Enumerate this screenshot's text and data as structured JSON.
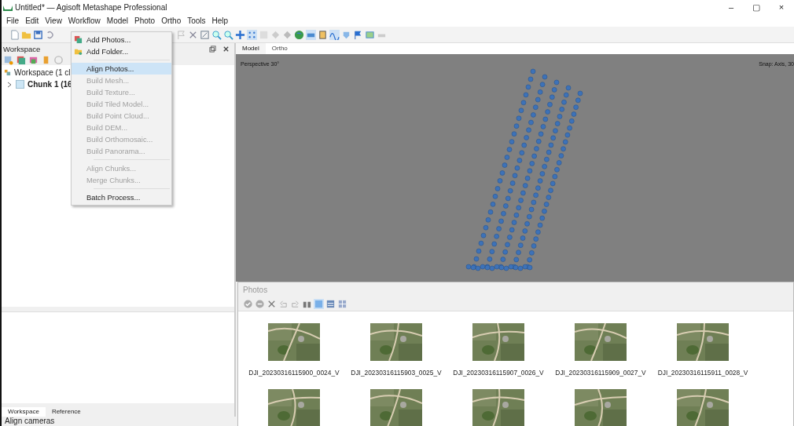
{
  "window": {
    "title": "Untitled* — Agisoft Metashape Professional",
    "controls": [
      "–",
      "▢",
      "×"
    ]
  },
  "menu_bar": [
    "File",
    "Edit",
    "View",
    "Workflow",
    "Model",
    "Photo",
    "Ortho",
    "Tools",
    "Help"
  ],
  "workflow_menu": [
    {
      "kind": "item",
      "label": "Add Photos...",
      "disabled": false,
      "selected": false
    },
    {
      "kind": "item",
      "label": "Add Folder...",
      "disabled": false,
      "selected": false
    },
    {
      "kind": "separator"
    },
    {
      "kind": "item",
      "label": "Align Photos...",
      "disabled": false,
      "selected": true
    },
    {
      "kind": "item",
      "label": "Build Mesh...",
      "disabled": true,
      "selected": false
    },
    {
      "kind": "item",
      "label": "Build Texture...",
      "disabled": true,
      "selected": false
    },
    {
      "kind": "item",
      "label": "Build Tiled Model...",
      "disabled": true,
      "selected": false
    },
    {
      "kind": "item",
      "label": "Build Point Cloud...",
      "disabled": true,
      "selected": false
    },
    {
      "kind": "item",
      "label": "Build DEM...",
      "disabled": true,
      "selected": false
    },
    {
      "kind": "item",
      "label": "Build Orthomosaic...",
      "disabled": true,
      "selected": false
    },
    {
      "kind": "item",
      "label": "Build Panorama...",
      "disabled": true,
      "selected": false
    },
    {
      "kind": "separator"
    },
    {
      "kind": "item",
      "label": "Align Chunks...",
      "disabled": true,
      "selected": false
    },
    {
      "kind": "item",
      "label": "Merge Chunks...",
      "disabled": true,
      "selected": false
    },
    {
      "kind": "separator"
    },
    {
      "kind": "item",
      "label": "Batch Process...",
      "disabled": false,
      "selected": false
    }
  ],
  "workspace": {
    "title": "Workspace",
    "tree": [
      {
        "label": "Workspace (1 cl",
        "children": [
          {
            "label": "Chunk 1 (16",
            "expanded": false
          }
        ]
      }
    ]
  },
  "viewport": {
    "tabs": [
      {
        "label": "Model",
        "selected": true
      },
      {
        "label": "Ortho",
        "selected": false
      }
    ],
    "projection": "Perspective 30°",
    "snap": "Snap: Axis, 30"
  },
  "photos": {
    "title": "Photos",
    "items": [
      {
        "kind": "picture",
        "label": "DJI_20230316115900_0024_V"
      },
      {
        "kind": "picture",
        "label": "DJI_20230316115903_0025_V"
      },
      {
        "kind": "picture",
        "label": "DJI_20230316115907_0026_V"
      },
      {
        "kind": "picture",
        "label": "DJI_20230316115909_0027_V"
      },
      {
        "kind": "picture",
        "label": "DJI_20230316115911_0028_V"
      },
      {
        "kind": "picture"
      },
      {
        "kind": "picture"
      },
      {
        "kind": "picture"
      },
      {
        "kind": "picture"
      },
      {
        "kind": "picture"
      }
    ]
  },
  "bottom_tabs": [
    {
      "label": "Workspace",
      "selected": true
    },
    {
      "label": "Reference",
      "selected": false
    }
  ],
  "status_bar": "Align cameras"
}
